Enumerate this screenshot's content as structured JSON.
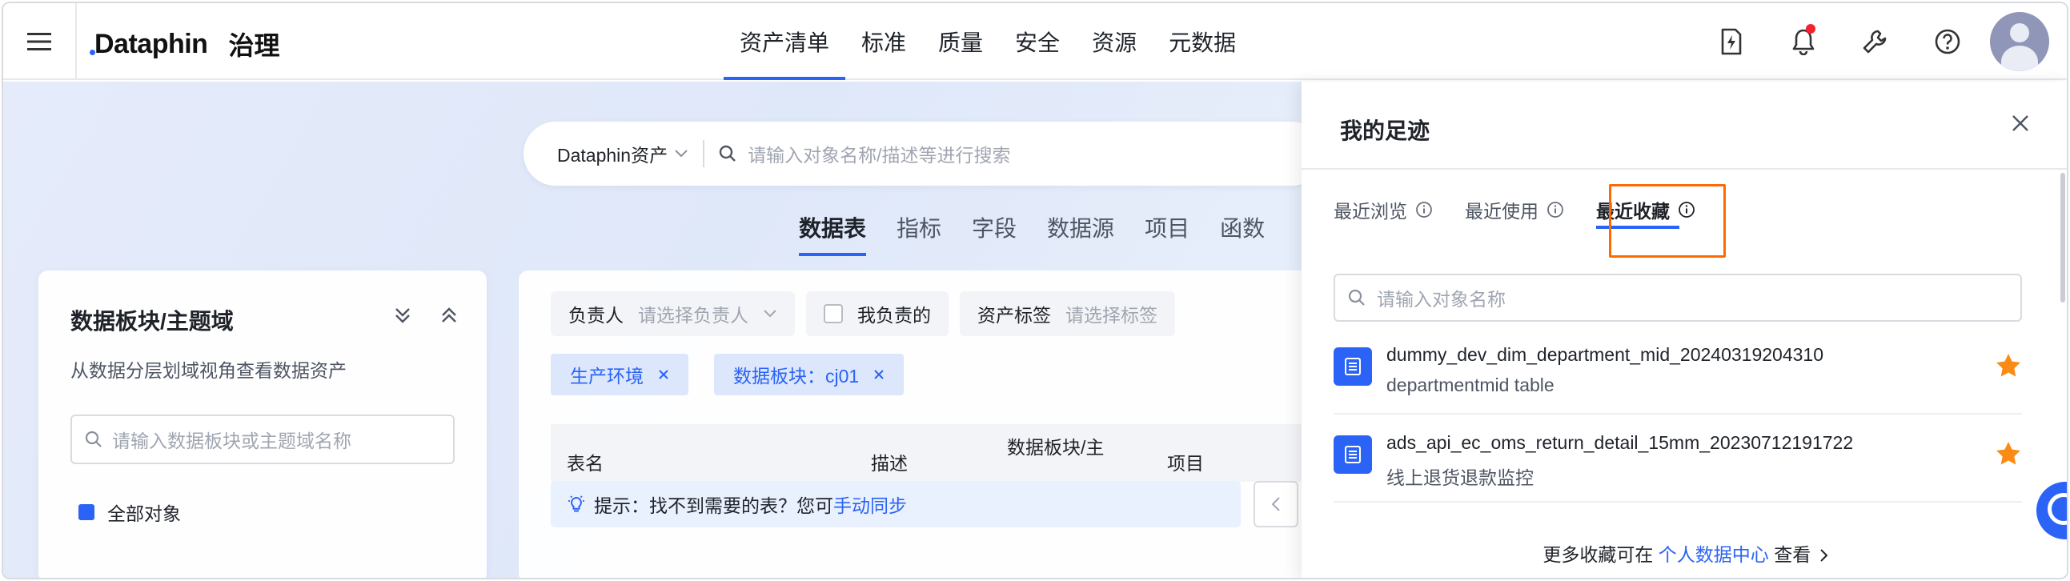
{
  "topbar": {
    "brand": "Dataphin",
    "module": "治理",
    "nav": [
      {
        "label": "资产清单",
        "active": true
      },
      {
        "label": "标准",
        "active": false
      },
      {
        "label": "质量",
        "active": false
      },
      {
        "label": "安全",
        "active": false
      },
      {
        "label": "资源",
        "active": false
      },
      {
        "label": "元数据",
        "active": false
      }
    ],
    "icons": [
      "lightning-file-icon",
      "bell-icon",
      "wrench-icon",
      "help-icon",
      "avatar"
    ]
  },
  "search": {
    "scope": "Dataphin资产",
    "placeholder": "请输入对象名称/描述等进行搜索"
  },
  "asset_tabs": [
    {
      "label": "数据表",
      "active": true
    },
    {
      "label": "指标",
      "active": false
    },
    {
      "label": "字段",
      "active": false
    },
    {
      "label": "数据源",
      "active": false
    },
    {
      "label": "项目",
      "active": false
    },
    {
      "label": "函数",
      "active": false
    }
  ],
  "left_panel": {
    "title": "数据板块/主题域",
    "description": "从数据分层划域视角查看数据资产",
    "search_placeholder": "请输入数据板块或主题域名称",
    "first_item": "全部对象"
  },
  "filters": {
    "owner_label": "负责人",
    "owner_placeholder": "请选择负责人",
    "mine_label": "我负责的",
    "tag_label": "资产标签",
    "tag_placeholder": "请选择标签",
    "chips": [
      "生产环境",
      "数据板块：cj01"
    ]
  },
  "table": {
    "columns": [
      "表名",
      "描述",
      "数据板块/主",
      "项目"
    ]
  },
  "tip": {
    "text": "提示：找不到需要的表？您可",
    "link": "手动同步"
  },
  "drawer": {
    "title": "我的足迹",
    "tabs": [
      {
        "label": "最近浏览",
        "active": false
      },
      {
        "label": "最近使用",
        "active": false
      },
      {
        "label": "最近收藏",
        "active": true
      }
    ],
    "search_placeholder": "请输入对象名称",
    "items": [
      {
        "name": "dummy_dev_dim_department_mid_20240319204310",
        "desc": "departmentmid table",
        "starred": true
      },
      {
        "name": "ads_api_ec_oms_return_detail_15mm_20230712191722",
        "desc": "线上退货退款监控",
        "starred": true
      }
    ],
    "footer_prefix": "更多收藏可在",
    "footer_link": "个人数据中心",
    "footer_suffix": "查看"
  },
  "colors": {
    "accent": "#2b63f6",
    "highlight": "#ff6a00",
    "star": "#fa8c16",
    "bell_dot": "#f5222d"
  }
}
